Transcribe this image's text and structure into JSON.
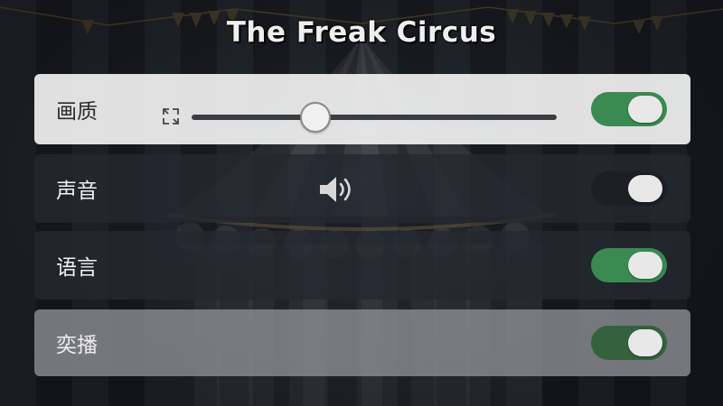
{
  "title": "The Freak Circus",
  "settings": [
    {
      "label": "画质",
      "control": "slider",
      "slider_value": 0.34,
      "toggle_on": true
    },
    {
      "label": "声音",
      "control": "speaker",
      "toggle_on": false
    },
    {
      "label": "语言",
      "toggle_on": true
    },
    {
      "label": "奕播",
      "toggle_on": true
    }
  ],
  "icons": {
    "quality": "expand-arrows-icon",
    "sound": "speaker-icon"
  },
  "colors": {
    "toggle_on": "#3a8a52",
    "toggle_off": "#1c1f24",
    "highlight_row": "#f0f0f0"
  }
}
